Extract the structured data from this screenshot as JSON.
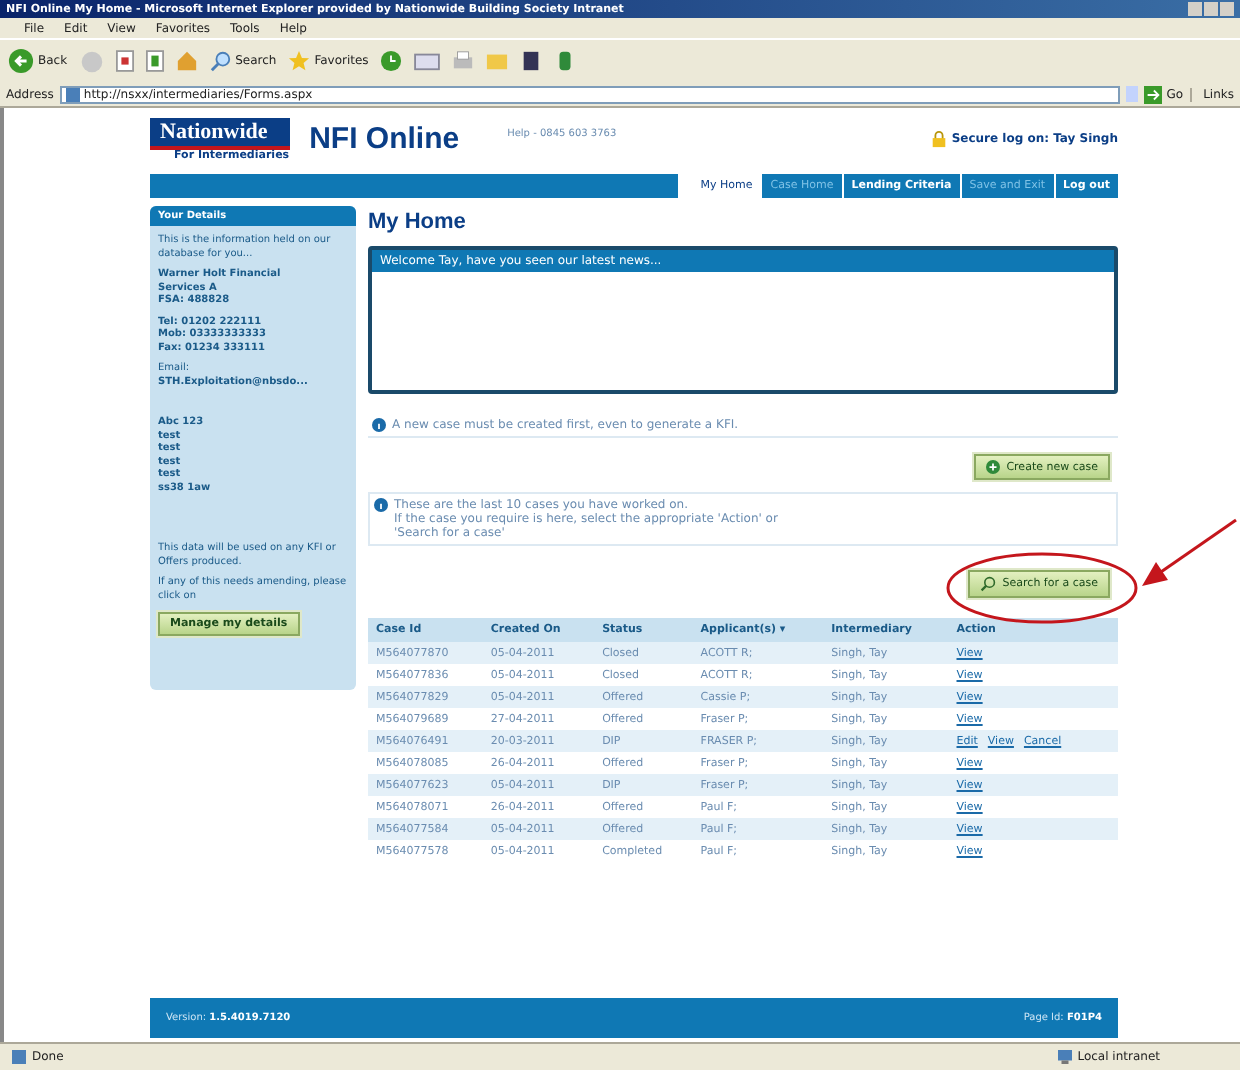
{
  "window": {
    "title": "NFI Online My Home - Microsoft Internet Explorer provided by Nationwide Building Society Intranet"
  },
  "menu": [
    "File",
    "Edit",
    "View",
    "Favorites",
    "Tools",
    "Help"
  ],
  "toolbar": {
    "back": "Back",
    "search": "Search",
    "favorites": "Favorites"
  },
  "address_bar": {
    "label": "Address",
    "value": "http://nsxx/intermediaries/Forms.aspx",
    "go": "Go",
    "links": "Links"
  },
  "header": {
    "brand": "Nationwide",
    "sub": "For Intermediaries",
    "product": "NFI Online",
    "help": "Help - 0845 603 3763",
    "secure": "Secure log on: Tay Singh"
  },
  "nav": [
    {
      "label": "My Home",
      "selected": true,
      "disabled": false
    },
    {
      "label": "Case Home",
      "selected": false,
      "disabled": true
    },
    {
      "label": "Lending Criteria",
      "selected": false,
      "disabled": false
    },
    {
      "label": "Save and Exit",
      "selected": false,
      "disabled": true
    },
    {
      "label": "Log out",
      "selected": false,
      "disabled": false
    }
  ],
  "sidebar": {
    "title": "Your Details",
    "intro": "This is the information held on our database for you...",
    "company": [
      "Warner Holt Financial",
      "Services A",
      "FSA: 488828"
    ],
    "phones": [
      "Tel: 01202 222111",
      "Mob: 03333333333",
      "Fax: 01234 333111"
    ],
    "email_label": "Email:",
    "email": "STH.Exploitation@nbsdo...",
    "address": [
      "Abc 123",
      "test",
      "test",
      "test",
      "test",
      "ss38 1aw"
    ],
    "note": "This data will be used on any KFI or Offers produced.",
    "amend": "If any of this needs amending, please click on",
    "button": "Manage my details"
  },
  "main": {
    "heading": "My Home",
    "news": "Welcome Tay, have you seen our latest news...",
    "info_new": "A new case must be created first, even to generate a KFI.",
    "create_button": "Create new case",
    "info_recent": [
      "These are the last 10 cases you have worked on.",
      "If the case you require is here, select the appropriate 'Action' or",
      "'Search for a case'"
    ],
    "search_button": "Search for a case"
  },
  "table": {
    "columns": [
      "Case Id",
      "Created On",
      "Status",
      "Applicant(s) ▾",
      "Intermediary",
      "Action"
    ],
    "rows": [
      {
        "cells": [
          "M564077870",
          "05-04-2011",
          "Closed",
          "ACOTT R;",
          "Singh, Tay"
        ],
        "actions": [
          "View"
        ]
      },
      {
        "cells": [
          "M564077836",
          "05-04-2011",
          "Closed",
          "ACOTT R;",
          "Singh, Tay"
        ],
        "actions": [
          "View"
        ]
      },
      {
        "cells": [
          "M564077829",
          "05-04-2011",
          "Offered",
          "Cassie P;",
          "Singh, Tay"
        ],
        "actions": [
          "View"
        ]
      },
      {
        "cells": [
          "M564079689",
          "27-04-2011",
          "Offered",
          "Fraser P;",
          "Singh, Tay"
        ],
        "actions": [
          "View"
        ]
      },
      {
        "cells": [
          "M564076491",
          "20-03-2011",
          "DIP",
          "FRASER P;",
          "Singh, Tay"
        ],
        "actions": [
          "Edit",
          "View",
          "Cancel"
        ]
      },
      {
        "cells": [
          "M564078085",
          "26-04-2011",
          "Offered",
          "Fraser P;",
          "Singh, Tay"
        ],
        "actions": [
          "View"
        ]
      },
      {
        "cells": [
          "M564077623",
          "05-04-2011",
          "DIP",
          "Fraser P;",
          "Singh, Tay"
        ],
        "actions": [
          "View"
        ]
      },
      {
        "cells": [
          "M564078071",
          "26-04-2011",
          "Offered",
          "Paul F;",
          "Singh, Tay"
        ],
        "actions": [
          "View"
        ]
      },
      {
        "cells": [
          "M564077584",
          "05-04-2011",
          "Offered",
          "Paul F;",
          "Singh, Tay"
        ],
        "actions": [
          "View"
        ]
      },
      {
        "cells": [
          "M564077578",
          "05-04-2011",
          "Completed",
          "Paul F;",
          "Singh, Tay"
        ],
        "actions": [
          "View"
        ]
      }
    ]
  },
  "footer": {
    "version_label": "Version:",
    "version": "1.5.4019.7120",
    "page_label": "Page Id:",
    "page": "F01P4"
  },
  "status_bar": {
    "left": "Done",
    "zone": "Local intranet"
  }
}
